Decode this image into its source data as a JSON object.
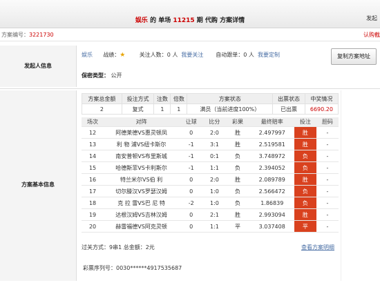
{
  "header": {
    "title_lottery": "娱乐",
    "title_mid": "的 单场",
    "title_period": "11215",
    "title_end": "期 代购 方案详情",
    "right": "发起"
  },
  "plan": {
    "label": "方案编号：",
    "number": "3221730",
    "buy": "认购截"
  },
  "initiator": {
    "section_label": "发起人信息",
    "username": "娱乐",
    "record_label": "战绩：",
    "star": "★",
    "followers_label": "关注人数：",
    "followers": "0 人",
    "follow_link": "我要关注",
    "autofollow_label": "自动跟单：",
    "autofollow": "0 人",
    "custom_link": "我要定制",
    "copy_button": "复制方案地址",
    "secret_label": "保密类型：",
    "secret_value": "公开"
  },
  "basic": {
    "section_label": "方案基本信息",
    "summary_headers": [
      "方案总金额",
      "投注方式",
      "注数",
      "倍数",
      "方案状态",
      "出票状态",
      "中奖情况"
    ],
    "summary": {
      "amount": "2",
      "method": "复式",
      "bets": "1",
      "multiple": "1",
      "status": "满员（当前进度100%）",
      "ticket": "已出票",
      "prize": "6690.20"
    },
    "match_headers": [
      "场次",
      "对阵",
      "让球",
      "比分",
      "彩果",
      "最终赔率",
      "投注",
      "胆码"
    ],
    "matches": [
      {
        "no": "12",
        "teams": "阿德莱德VS惠灵顿凤",
        "handicap": "0",
        "score": "2:0",
        "result": "胜",
        "odds": "2.497997",
        "bet": "胜",
        "banker": "-"
      },
      {
        "no": "13",
        "teams": "利 物 浦VS纽卡斯尔",
        "handicap": "-1",
        "score": "3:1",
        "result": "胜",
        "odds": "2.519581",
        "bet": "胜",
        "banker": "-"
      },
      {
        "no": "14",
        "teams": "南安普顿VS布里斯城",
        "handicap": "-1",
        "score": "0:1",
        "result": "负",
        "odds": "3.748972",
        "bet": "负",
        "banker": "-"
      },
      {
        "no": "15",
        "teams": "哈德斯菲VS卡利斯尔",
        "handicap": "-1",
        "score": "1:1",
        "result": "负",
        "odds": "2.394052",
        "bet": "负",
        "banker": "-"
      },
      {
        "no": "16",
        "teams": "特兰米尔VS伯 利",
        "handicap": "0",
        "score": "2:0",
        "result": "胜",
        "odds": "2.089789",
        "bet": "胜",
        "banker": "-"
      },
      {
        "no": "17",
        "teams": "切尔滕汉VS罗瑟汉姆",
        "handicap": "0",
        "score": "1:0",
        "result": "负",
        "odds": "2.566472",
        "bet": "负",
        "banker": "-"
      },
      {
        "no": "18",
        "teams": "克 拉 雷VS巴 尼 特",
        "handicap": "-2",
        "score": "1:0",
        "result": "负",
        "odds": "1.86839",
        "bet": "负",
        "banker": "-"
      },
      {
        "no": "19",
        "teams": "达根汉姆VS吉林汉姆",
        "handicap": "0",
        "score": "2:1",
        "result": "胜",
        "odds": "2.993094",
        "bet": "胜",
        "banker": "-"
      },
      {
        "no": "20",
        "teams": "赫雷福德VS阿克灵顿",
        "handicap": "0",
        "score": "1:1",
        "result": "平",
        "odds": "3.037408",
        "bet": "平",
        "banker": "-"
      }
    ],
    "pass_info": "过关方式：9串1 总金额：2元",
    "detail_link": "查看方案明细",
    "ticket_serial": "彩票序列号：0030******4917535687"
  },
  "colors": {
    "accent": "#c00000",
    "bet_cell": "#d9411e",
    "link": "#4a6fa5"
  }
}
